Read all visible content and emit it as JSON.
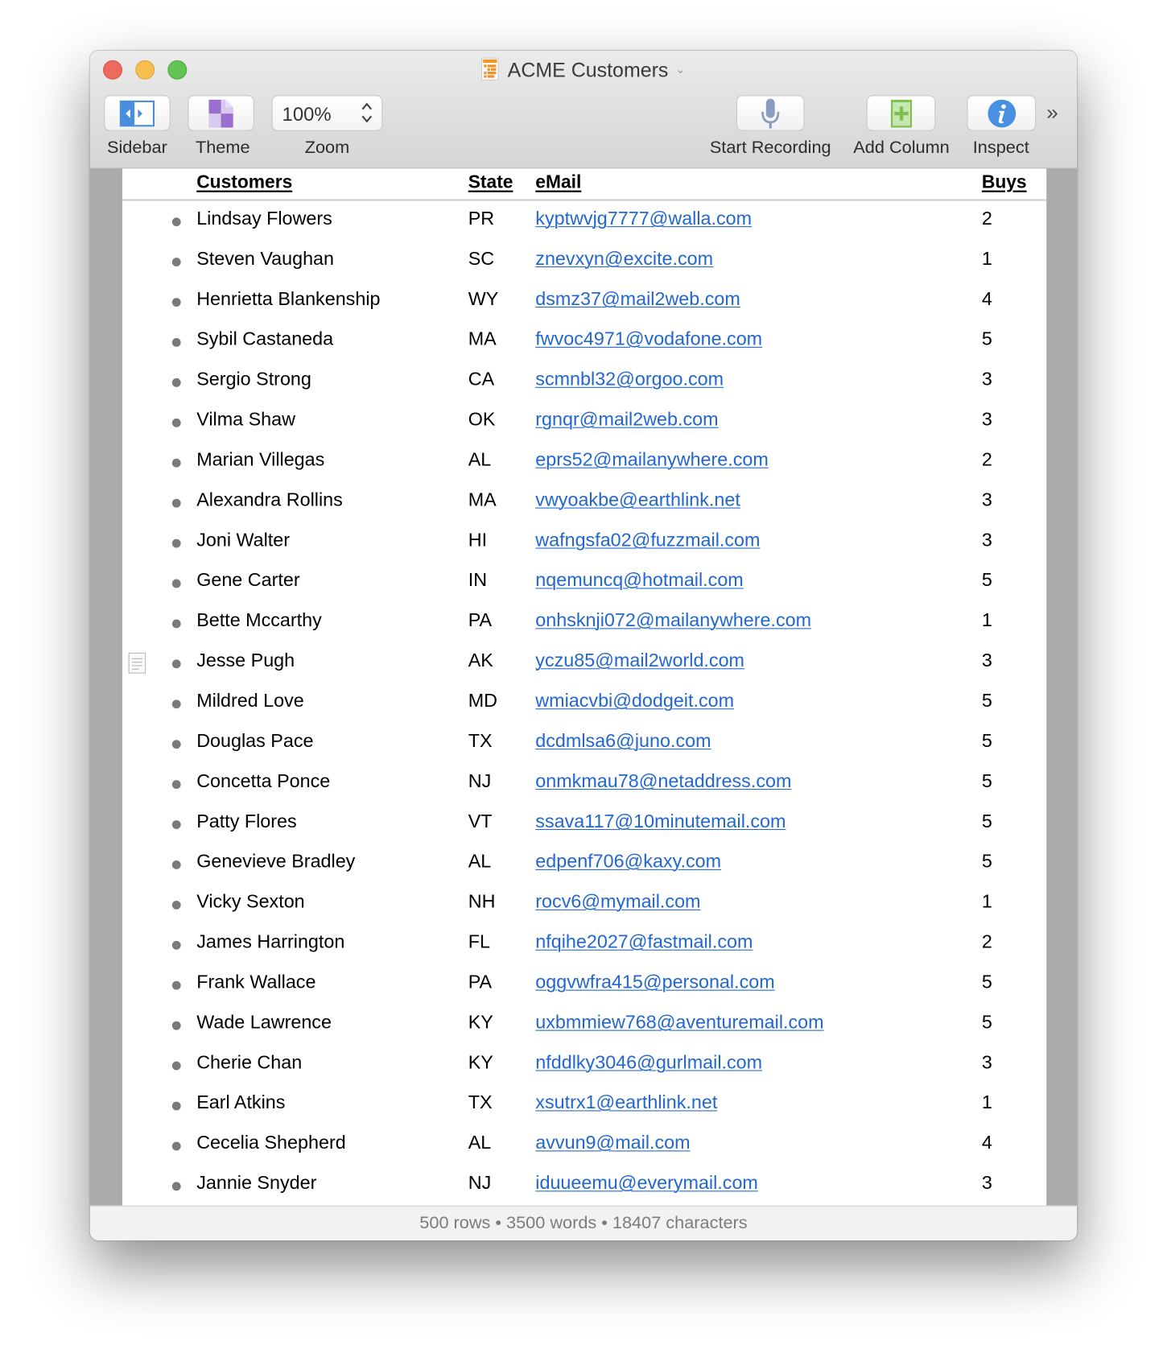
{
  "window": {
    "title": "ACME Customers",
    "title_icon": "outline-document-icon",
    "title_chevron": "chevron-down-icon"
  },
  "toolbar": {
    "sidebar": {
      "label": "Sidebar",
      "icon": "sidebar-toggle-icon"
    },
    "theme": {
      "label": "Theme",
      "icon": "theme-icon"
    },
    "zoom": {
      "label": "Zoom",
      "value": "100%",
      "icon": "stepper-icon"
    },
    "start_recording": {
      "label": "Start Recording",
      "icon": "microphone-icon"
    },
    "add_column": {
      "label": "Add Column",
      "icon": "add-column-icon"
    },
    "inspect": {
      "label": "Inspect",
      "icon": "info-icon"
    },
    "overflow": "»"
  },
  "colors": {
    "link": "#2167cf",
    "close": "#ef6a5e",
    "minimize": "#f6be4f",
    "maximize": "#61c454",
    "inspect_blue": "#4a90e2",
    "add_column_green": "#7dc052",
    "theme_purple": "#9b6fcf",
    "sidebar_blue": "#4a8fdf"
  },
  "table": {
    "columns": [
      "Customers",
      "State",
      "eMail",
      "Buys"
    ],
    "rows": [
      {
        "name": "Lindsay Flowers",
        "state": "PR",
        "email": "kyptwvjg7777@walla.com",
        "buys": "2"
      },
      {
        "name": "Steven Vaughan",
        "state": "SC",
        "email": "znevxyn@excite.com",
        "buys": "1"
      },
      {
        "name": "Henrietta Blankenship",
        "state": "WY",
        "email": "dsmz37@mail2web.com",
        "buys": "4"
      },
      {
        "name": "Sybil Castaneda",
        "state": "MA",
        "email": "fwvoc4971@vodafone.com",
        "buys": "5"
      },
      {
        "name": "Sergio Strong",
        "state": "CA",
        "email": "scmnbl32@orgoo.com",
        "buys": "3"
      },
      {
        "name": "Vilma Shaw",
        "state": "OK",
        "email": "rgnqr@mail2web.com",
        "buys": "3"
      },
      {
        "name": "Marian Villegas",
        "state": "AL",
        "email": "eprs52@mailanywhere.com",
        "buys": "2"
      },
      {
        "name": "Alexandra Rollins",
        "state": "MA",
        "email": "vwyoakbe@earthlink.net",
        "buys": "3"
      },
      {
        "name": "Joni Walter",
        "state": "HI",
        "email": "wafngsfa02@fuzzmail.com",
        "buys": "3"
      },
      {
        "name": "Gene Carter",
        "state": "IN",
        "email": "nqemuncq@hotmail.com",
        "buys": "5"
      },
      {
        "name": "Bette Mccarthy",
        "state": "PA",
        "email": "onhsknji072@mailanywhere.com",
        "buys": "1"
      },
      {
        "name": "Jesse Pugh",
        "state": "AK",
        "email": "yczu85@mail2world.com",
        "buys": "3",
        "has_note": true
      },
      {
        "name": "Mildred Love",
        "state": "MD",
        "email": "wmiacvbi@dodgeit.com",
        "buys": "5"
      },
      {
        "name": "Douglas Pace",
        "state": "TX",
        "email": "dcdmlsa6@juno.com",
        "buys": "5"
      },
      {
        "name": "Concetta Ponce",
        "state": "NJ",
        "email": "onmkmau78@netaddress.com",
        "buys": "5"
      },
      {
        "name": "Patty Flores",
        "state": "VT",
        "email": "ssava117@10minutemail.com",
        "buys": "5"
      },
      {
        "name": "Genevieve Bradley",
        "state": "AL",
        "email": "edpenf706@kaxy.com",
        "buys": "5"
      },
      {
        "name": "Vicky Sexton",
        "state": "NH",
        "email": "rocv6@mymail.com",
        "buys": "1"
      },
      {
        "name": "James Harrington",
        "state": "FL",
        "email": "nfqihe2027@fastmail.com",
        "buys": "2"
      },
      {
        "name": "Frank Wallace",
        "state": "PA",
        "email": "oggvwfra415@personal.com",
        "buys": "5"
      },
      {
        "name": "Wade Lawrence",
        "state": "KY",
        "email": "uxbmmiew768@aventuremail.com",
        "buys": "5"
      },
      {
        "name": "Cherie Chan",
        "state": "KY",
        "email": "nfddlky3046@gurlmail.com",
        "buys": "3"
      },
      {
        "name": "Earl Atkins",
        "state": "TX",
        "email": "xsutrx1@earthlink.net",
        "buys": "1"
      },
      {
        "name": "Cecelia Shepherd",
        "state": "AL",
        "email": "avvun9@mail.com",
        "buys": "4"
      },
      {
        "name": "Jannie Snyder",
        "state": "NJ",
        "email": "iduueemu@everymail.com",
        "buys": "3"
      }
    ]
  },
  "status": "500 rows • 3500 words • 18407 characters"
}
